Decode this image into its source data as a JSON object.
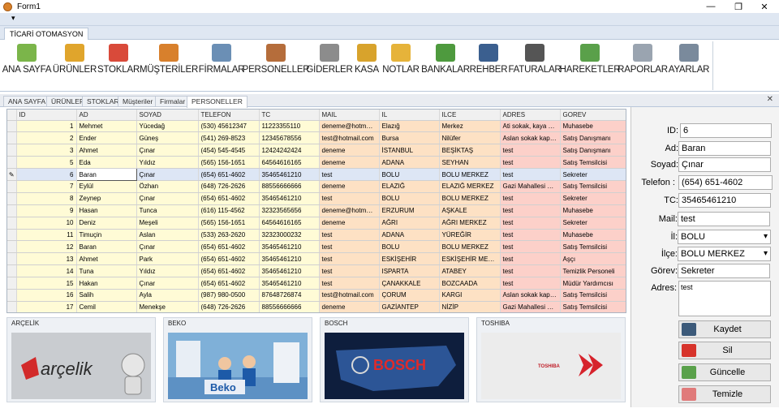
{
  "window": {
    "title": "Form1"
  },
  "qat": {
    "arrow": "▾"
  },
  "ribbon": {
    "tab": "TİCARİ OTOMASYON",
    "buttons": [
      {
        "label": "ANA SAYFA",
        "icon": "home-icon",
        "color": "#7bb54a"
      },
      {
        "label": "ÜRÜNLER",
        "icon": "boxes-icon",
        "color": "#e0a52c"
      },
      {
        "label": "STOKLAR",
        "icon": "chart-line-icon",
        "color": "#d94a3a"
      },
      {
        "label": "MÜŞTERİLER",
        "icon": "users-icon",
        "color": "#d8802c"
      },
      {
        "label": "FİRMALAR",
        "icon": "business-card-icon",
        "color": "#6b8fb5"
      },
      {
        "label": "PERSONELLER",
        "icon": "staff-icon",
        "color": "#b56d3b"
      },
      {
        "label": "GİDERLER",
        "icon": "expense-icon",
        "color": "#8c8c8c"
      },
      {
        "label": "KASA",
        "icon": "coins-icon",
        "color": "#d8a32c"
      },
      {
        "label": "NOTLAR",
        "icon": "notes-icon",
        "color": "#e6b33a"
      },
      {
        "label": "BANKALAR",
        "icon": "bank-icon",
        "color": "#4e9a3e"
      },
      {
        "label": "REHBER",
        "icon": "phone-icon",
        "color": "#3b5f8f"
      },
      {
        "label": "FATURALAR",
        "icon": "barcode-icon",
        "color": "#555555"
      },
      {
        "label": "HAREKETLER",
        "icon": "bar-chart-icon",
        "color": "#5aa04a"
      },
      {
        "label": "RAPORLAR",
        "icon": "report-icon",
        "color": "#9aa4b0"
      },
      {
        "label": "AYARLAR",
        "icon": "gear-icon",
        "color": "#7a8a9c"
      }
    ]
  },
  "doc_tabs": [
    {
      "label": "ANA SAYFA"
    },
    {
      "label": "ÜRÜNLER"
    },
    {
      "label": "STOKLAR"
    },
    {
      "label": "Müşteriler"
    },
    {
      "label": "Firmalar"
    },
    {
      "label": "PERSONELLER"
    }
  ],
  "grid": {
    "columns": [
      "ID",
      "AD",
      "SOYAD",
      "TELEFON",
      "TC",
      "MAIL",
      "IL",
      "ILCE",
      "ADRES",
      "GOREV"
    ],
    "current_row": 4,
    "rows": [
      [
        "1",
        "Mehmet",
        "Yücedağ",
        "(530) 45612347",
        "11223355110",
        "deneme@hotmail....",
        "Elazığ",
        "Merkez",
        "Ati sokak, kaya a...",
        "Muhasebe"
      ],
      [
        "2",
        "Ender",
        "Güneş",
        "(541) 269-8523",
        "12345678556",
        "test@hotmail.com",
        "Bursa",
        "Nilüfer",
        "Aslan sokak kapla...",
        "Satış Danışmanı"
      ],
      [
        "3",
        "Ahmet",
        "Çınar",
        "(454) 545-4545",
        "12424242424",
        "deneme",
        "İSTANBUL",
        "BEŞİKTAŞ",
        "test",
        "Satış Danışmanı"
      ],
      [
        "5",
        "Eda",
        "Yıldız",
        "(565) 156-1651",
        "64564616165",
        "deneme",
        "ADANA",
        "SEYHAN",
        "test",
        "Satış Temsilcisi"
      ],
      [
        "6",
        "Baran",
        "Çınar",
        "(654) 651-4602",
        "35465461210",
        "test",
        "BOLU",
        "BOLU MERKEZ",
        "test",
        "Sekreter"
      ],
      [
        "7",
        "Eylül",
        "Özhan",
        "(648) 726-2626",
        "88556666666",
        "deneme",
        "ELAZIĞ",
        "ELAZIĞ MERKEZ",
        "Gazi Mahallesi No:...",
        "Satış Temsilcisi"
      ],
      [
        "8",
        "Zeynep",
        "Çınar",
        "(654) 651-4602",
        "35465461210",
        "test",
        "BOLU",
        "BOLU MERKEZ",
        "test",
        "Sekreter"
      ],
      [
        "9",
        "Hasan",
        "Tunca",
        "(616) 115-4562",
        "32323565656",
        "deneme@hotmail....",
        "ERZURUM",
        "AŞKALE",
        "test",
        "Muhasebe"
      ],
      [
        "10",
        "Deniz",
        "Meşeli",
        "(565) 156-1651",
        "64564616165",
        "deneme",
        "AĞRI",
        "AĞRI MERKEZ",
        "test",
        "Sekreter"
      ],
      [
        "11",
        "Timuçin",
        "Aslan",
        "(533) 263-2620",
        "32323000232",
        "test",
        "ADANA",
        "YÜREĞİR",
        "test",
        "Muhasebe"
      ],
      [
        "12",
        "Baran",
        "Çınar",
        "(654) 651-4602",
        "35465461210",
        "test",
        "BOLU",
        "BOLU MERKEZ",
        "test",
        "Satış Temsilcisi"
      ],
      [
        "13",
        "Ahmet",
        "Park",
        "(654) 651-4602",
        "35465461210",
        "test",
        "ESKİŞEHİR",
        "ESKİŞEHİR MERKEZ",
        "test",
        "Aşçı"
      ],
      [
        "14",
        "Tuna",
        "Yıldız",
        "(654) 651-4602",
        "35465461210",
        "test",
        "ISPARTA",
        "ATABEY",
        "test",
        "Temizlik Personeli"
      ],
      [
        "15",
        "Hakan",
        "Çınar",
        "(654) 651-4602",
        "35465461210",
        "test",
        "ÇANAKKALE",
        "BOZCAADA",
        "test",
        "Müdür Yardımcısı"
      ],
      [
        "16",
        "Salih",
        "Ayla",
        "(987) 980-0500",
        "87648726874",
        "test@hotmail.com",
        "ÇORUM",
        "KARGI",
        "Aslan sokak kapla...",
        "Satış Temsilcisi"
      ],
      [
        "17",
        "Cemil",
        "Menekşe",
        "(648) 726-2626",
        "88556666666",
        "deneme",
        "GAZİANTEP",
        "NİZİP",
        "Gazi Mahallesi No:...",
        "Satış Temsilcisi"
      ]
    ]
  },
  "brands": [
    {
      "title": "ARÇELİK",
      "logo": "arçelik",
      "bg": "#c9ccd0"
    },
    {
      "title": "BEKO",
      "logo": "Beko",
      "bg": "#7fb0d8"
    },
    {
      "title": "BOSCH",
      "logo": "BOSCH",
      "bg": "#1d3f73"
    },
    {
      "title": "TOSHIBA",
      "logo": "TOSHIBA",
      "bg": "#e9e9e9"
    }
  ],
  "form": {
    "id_label": "ID:",
    "id_value": "6",
    "ad_label": "Ad:",
    "ad_value": "Baran",
    "soyad_label": "Soyad:",
    "soyad_value": "Çınar",
    "telefon_label": "Telefon :",
    "telefon_value": "(654) 651-4602",
    "tc_label": "TC:",
    "tc_value": "35465461210",
    "mail_label": "Mail:",
    "mail_value": "test",
    "il_label": "İl:",
    "il_value": "BOLU",
    "ilce_label": "İlçe:",
    "ilce_value": "BOLU MERKEZ",
    "gorev_label": "Görev:",
    "gorev_value": "Sekreter",
    "adres_label": "Adres:",
    "adres_value": "test",
    "buttons": {
      "kaydet": "Kaydet",
      "sil": "Sil",
      "guncelle": "Güncelle",
      "temizle": "Temizle"
    }
  }
}
